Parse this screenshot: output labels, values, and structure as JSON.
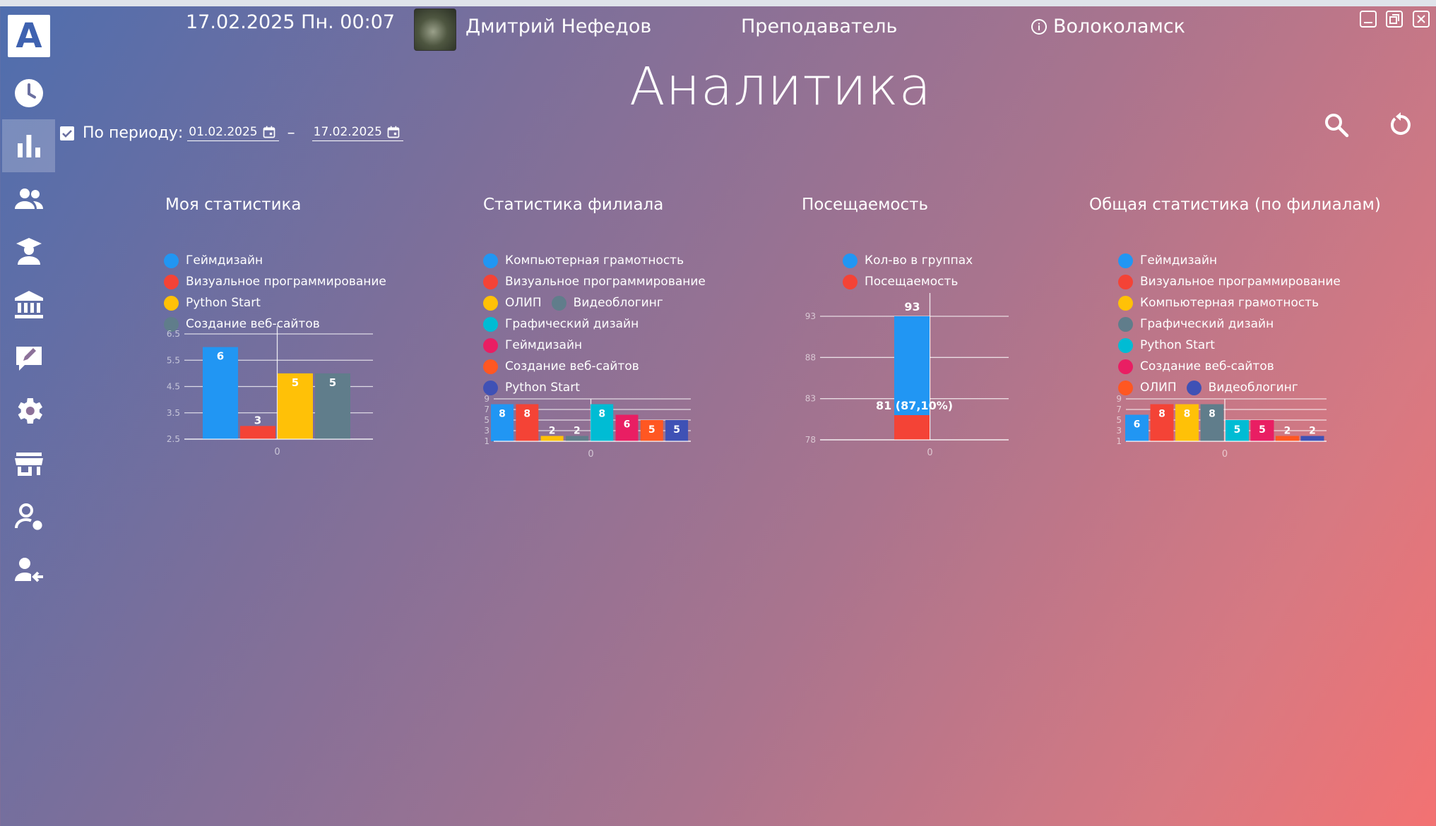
{
  "header": {
    "datetime": "17.02.2025 Пн. 00:07",
    "user_name": "Дмитрий Нефедов",
    "role": "Преподаватель",
    "branch": "Волоколамск"
  },
  "logo_letter": "A",
  "page_title": "Аналитика",
  "filter": {
    "checkbox_checked": true,
    "label": "По периоду:",
    "date_from": "01.02.2025",
    "dash": "–",
    "date_to": "17.02.2025"
  },
  "sidebar": {
    "items": [
      {
        "icon": "clock-icon"
      },
      {
        "icon": "bar-chart-icon",
        "active": true
      },
      {
        "icon": "people-icon"
      },
      {
        "icon": "graduate-icon"
      },
      {
        "icon": "bank-icon"
      },
      {
        "icon": "edit-icon"
      },
      {
        "icon": "gear-icon"
      },
      {
        "icon": "store-icon"
      },
      {
        "icon": "user-settings-icon"
      },
      {
        "icon": "user-logout-icon"
      }
    ]
  },
  "colors": {
    "blue": "#2196f3",
    "red": "#f44336",
    "yellow": "#ffc107",
    "grey": "#607d8b",
    "cyan": "#00bcd4",
    "pink": "#e91e63",
    "orange": "#ff5722",
    "indigo": "#3f51b5"
  },
  "chart_data": [
    {
      "type": "bar",
      "title": "Моя статистика",
      "categories": [
        "0"
      ],
      "ylim": [
        2.5,
        6.5
      ],
      "yticks": [
        "6.5",
        "5.5",
        "4.5",
        "3.5",
        "2.5"
      ],
      "series": [
        {
          "name": "Геймдизайн",
          "values": [
            6
          ],
          "color": "#2196f3"
        },
        {
          "name": "Визуальное программирование",
          "values": [
            3
          ],
          "color": "#f44336"
        },
        {
          "name": "Python Start",
          "values": [
            5
          ],
          "color": "#ffc107"
        },
        {
          "name": "Создание веб-сайтов",
          "values": [
            5
          ],
          "color": "#607d8b"
        }
      ]
    },
    {
      "type": "bar",
      "title": "Статистика филиала",
      "categories": [
        "0"
      ],
      "ylim": [
        1,
        9
      ],
      "yticks": [
        "9",
        "7",
        "5",
        "3",
        "1"
      ],
      "series": [
        {
          "name": "Компьютерная грамотность",
          "values": [
            8
          ],
          "color": "#2196f3"
        },
        {
          "name": "Визуальное программирование",
          "values": [
            8
          ],
          "color": "#f44336"
        },
        {
          "name": "ОЛИП",
          "values": [
            2
          ],
          "color": "#ffc107"
        },
        {
          "name": "Видеоблогинг",
          "values": [
            2
          ],
          "color": "#607d8b"
        },
        {
          "name": "Графический дизайн",
          "values": [
            8
          ],
          "color": "#00bcd4"
        },
        {
          "name": "Геймдизайн",
          "values": [
            6
          ],
          "color": "#e91e63"
        },
        {
          "name": "Создание веб-сайтов",
          "values": [
            5
          ],
          "color": "#ff5722"
        },
        {
          "name": "Python Start",
          "values": [
            5
          ],
          "color": "#3f51b5"
        }
      ]
    },
    {
      "type": "bar",
      "title": "Посещаемость",
      "categories": [
        "0"
      ],
      "ylim": [
        78,
        93
      ],
      "yticks": [
        "93",
        "88",
        "83",
        "78"
      ],
      "stacked": true,
      "series": [
        {
          "name": "Кол-во в группах",
          "values": [
            93
          ],
          "color": "#2196f3",
          "label": "93"
        },
        {
          "name": "Посещаемость",
          "values": [
            81
          ],
          "color": "#f44336",
          "label": "81 (87,10%)"
        }
      ]
    },
    {
      "type": "bar",
      "title": "Общая статистика (по филиалам)",
      "categories": [
        "0"
      ],
      "ylim": [
        1,
        9
      ],
      "yticks": [
        "9",
        "7",
        "5",
        "3",
        "1"
      ],
      "series": [
        {
          "name": "Геймдизайн",
          "values": [
            6
          ],
          "color": "#2196f3"
        },
        {
          "name": "Визуальное программирование",
          "values": [
            8
          ],
          "color": "#f44336"
        },
        {
          "name": "Компьютерная грамотность",
          "values": [
            8
          ],
          "color": "#ffc107"
        },
        {
          "name": "Графический дизайн",
          "values": [
            8
          ],
          "color": "#607d8b"
        },
        {
          "name": "Python Start",
          "values": [
            5
          ],
          "color": "#00bcd4"
        },
        {
          "name": "Создание веб-сайтов",
          "values": [
            5
          ],
          "color": "#e91e63"
        },
        {
          "name": "ОЛИП",
          "values": [
            2
          ],
          "color": "#ff5722"
        },
        {
          "name": "Видеоблогинг",
          "values": [
            2
          ],
          "color": "#3f51b5"
        }
      ]
    }
  ]
}
